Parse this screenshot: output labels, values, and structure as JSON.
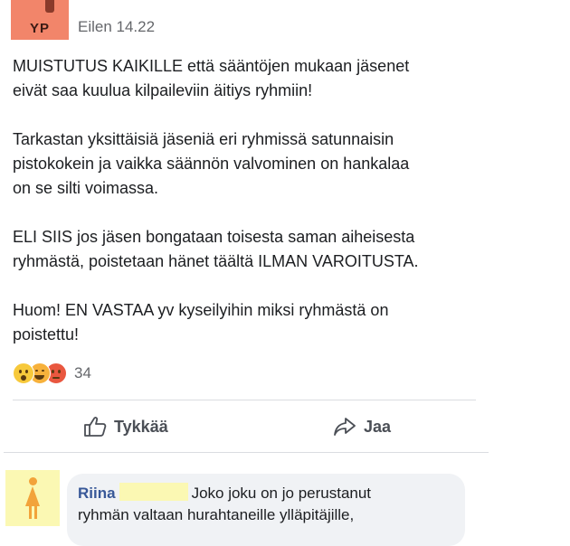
{
  "post": {
    "author_initials": "YP",
    "timestamp": "Eilen 14.22",
    "paragraphs": [
      "MUISTUTUS KAIKILLE että sääntöjen mukaan jäsenet\neivät saa kuulua kilpaileviin äitiys ryhmiin!",
      "Tarkastan yksittäisiä jäseniä eri ryhmissä satunnaisin\npistokokein ja vaikka säännön valvominen on hankalaa\non se silti voimassa.",
      "ELI SIIS jos jäsen bongataan toisesta saman aiheisesta\nryhmästä, poistetaan hänet täältä ILMAN VAROITUSTA.",
      "Huom! EN VASTAA yv kyseilyihin miksi ryhmästä on\npoistettu!"
    ],
    "reactions": {
      "icons": [
        "wow-reaction-icon",
        "haha-reaction-icon",
        "angry-reaction-icon"
      ],
      "count": "34"
    },
    "actions": {
      "like_label": "Tykkää",
      "share_label": "Jaa"
    }
  },
  "comment": {
    "author": "Riina",
    "text_line1": "Joko joku on jo perustanut",
    "text_line2": "ryhmän valtaan hurahtaneille ylläpitäjille,"
  },
  "colors": {
    "avatar_bg": "#f2856a",
    "comment_avatar_bg": "#fbf8b3",
    "link_blue": "#385898",
    "muted_gray": "#65676b"
  }
}
